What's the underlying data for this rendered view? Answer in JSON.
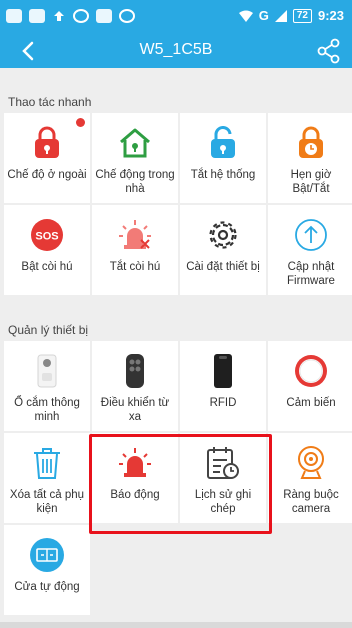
{
  "status_bar": {
    "network": "G",
    "battery": "72",
    "time": "9:23"
  },
  "header": {
    "title": "W5_1C5B"
  },
  "quick_actions": {
    "title": "Thao tác nhanh",
    "items": [
      {
        "label": "Chế độ ở ngoài",
        "icon": "lock-away-icon",
        "color": "#e53935",
        "badge": true
      },
      {
        "label": "Chế động trong nhà",
        "icon": "home-icon",
        "color": "#2e9e42",
        "badge": false
      },
      {
        "label": "Tắt hệ thống",
        "icon": "unlock-icon",
        "color": "#29a9e3",
        "badge": false
      },
      {
        "label": "Hẹn giờ Bật/Tắt",
        "icon": "lock-timer-icon",
        "color": "#f07c17",
        "badge": false
      },
      {
        "label": "Bật còi hú",
        "icon": "sos-icon",
        "color": "#e53935",
        "badge": false
      },
      {
        "label": "Tắt còi hú",
        "icon": "siren-off-icon",
        "color": "#e53935",
        "badge": false
      },
      {
        "label": "Cài đặt thiết bị",
        "icon": "gear-icon",
        "color": "#333333",
        "badge": false
      },
      {
        "label": "Cập nhật Firmware",
        "icon": "upload-icon",
        "color": "#29a9e3",
        "badge": false
      }
    ]
  },
  "device_management": {
    "title": "Quản lý thiết bị",
    "items": [
      {
        "label": "Ổ cắm thông minh",
        "icon": "smart-plug-icon"
      },
      {
        "label": "Điều khiển từ xa",
        "icon": "remote-control-icon"
      },
      {
        "label": "RFID",
        "icon": "rfid-card-icon"
      },
      {
        "label": "Cảm biến",
        "icon": "sensor-icon"
      },
      {
        "label": "Xóa tất cả phụ kiện",
        "icon": "trash-icon"
      },
      {
        "label": "Báo động",
        "icon": "alarm-siren-icon"
      },
      {
        "label": "Lịch sử ghi chép",
        "icon": "history-log-icon"
      },
      {
        "label": "Ràng buộc camera",
        "icon": "camera-icon"
      },
      {
        "label": "Cửa tự động",
        "icon": "auto-door-icon"
      }
    ]
  }
}
